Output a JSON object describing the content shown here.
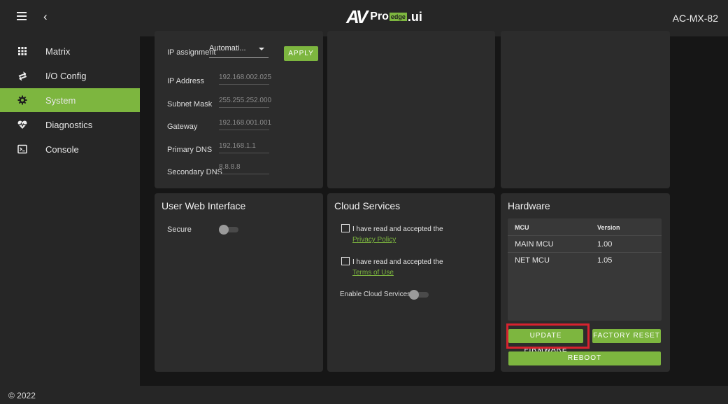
{
  "header": {
    "logo_av": "AV",
    "logo_pro": "Pro",
    "logo_edge": "edge",
    "logo_ui": ".ui",
    "device": "AC-MX-82"
  },
  "sidebar": {
    "items": [
      {
        "label": "Matrix",
        "icon": "grid-icon"
      },
      {
        "label": "I/O Config",
        "icon": "swap-arrows-icon"
      },
      {
        "label": "System",
        "icon": "gear-icon",
        "active": true
      },
      {
        "label": "Diagnostics",
        "icon": "heartbeat-icon"
      },
      {
        "label": "Console",
        "icon": "terminal-icon"
      }
    ]
  },
  "network": {
    "ip_assignment_label": "IP assignment",
    "ip_assignment_value": "Automati...",
    "apply_label": "APPLY",
    "ip_address_label": "IP Address",
    "ip_address_value": "192.168.002.025",
    "subnet_label": "Subnet Mask",
    "subnet_value": "255.255.252.000",
    "gateway_label": "Gateway",
    "gateway_value": "192.168.001.001",
    "primary_dns_label": "Primary DNS",
    "primary_dns_value": "192.168.1.1",
    "secondary_dns_label": "Secondary DNS",
    "secondary_dns_value": "8.8.8.8"
  },
  "web_interface": {
    "title": "User Web Interface",
    "secure_label": "Secure",
    "secure_on": false
  },
  "cloud": {
    "title": "Cloud Services",
    "privacy_text": "I have read and accepted the",
    "privacy_link": "Privacy Policy",
    "terms_text": "I have read and accepted the",
    "terms_link": "Terms of Use",
    "enable_label": "Enable Cloud Services",
    "enable_on": false
  },
  "hardware": {
    "title": "Hardware",
    "col_mcu": "MCU",
    "col_version": "Version",
    "rows": [
      {
        "mcu": "MAIN MCU",
        "version": "1.00"
      },
      {
        "mcu": "NET MCU",
        "version": "1.05"
      }
    ],
    "update_label": "UPDATE FIRMWARE",
    "factory_label": "FACTORY RESET",
    "reboot_label": "REBOOT"
  },
  "footer": {
    "copyright": "© 2022"
  },
  "colors": {
    "accent": "#7db63f",
    "highlight": "#d6232f",
    "panel": "#2c2c2c",
    "background": "#161616"
  }
}
